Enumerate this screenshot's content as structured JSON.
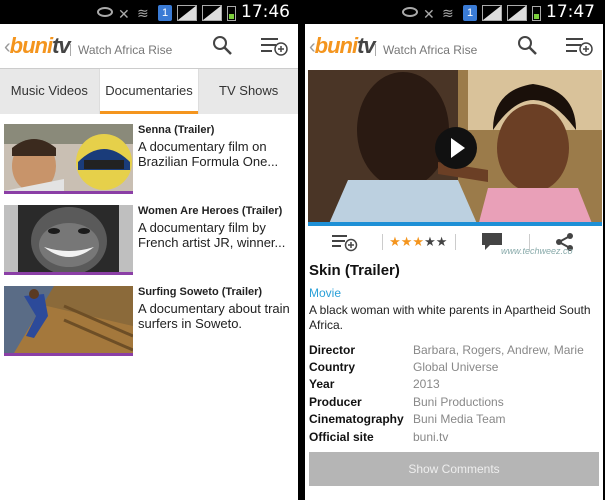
{
  "status": {
    "badge": "1",
    "time_left": "17:46",
    "time_right": "17:47"
  },
  "appbar": {
    "logo_buni": "buni",
    "logo_tv": "tv",
    "tagline": "Watch Africa Rise"
  },
  "tabs": [
    {
      "label": "Music Videos",
      "active": false
    },
    {
      "label": "Documentaries",
      "active": true
    },
    {
      "label": "TV Shows",
      "active": false
    }
  ],
  "list": [
    {
      "title": "Senna (Trailer)",
      "description": "A documentary film on Brazilian Formula One..."
    },
    {
      "title": "Women Are Heroes (Trailer)",
      "description": "A documentary film by French artist JR, winner..."
    },
    {
      "title": "Surfing Soweto (Trailer)",
      "description": "A documentary about train surfers in Soweto."
    }
  ],
  "detail": {
    "rating": 3,
    "rating_max": 5,
    "watermark": "www.techweez.co",
    "title": "Skin (Trailer)",
    "genre": "Movie",
    "description": "A black woman with white parents in Apartheid South Africa.",
    "meta": [
      {
        "key": "Director",
        "value": "Barbara, Rogers, Andrew, Marie"
      },
      {
        "key": "Country",
        "value": "Global Universe"
      },
      {
        "key": "Year",
        "value": "2013"
      },
      {
        "key": "Producer",
        "value": "Buni Productions"
      },
      {
        "key": "Cinematography",
        "value": "Buni Media Team"
      },
      {
        "key": "Official site",
        "value": "buni.tv"
      }
    ],
    "comments_button": "Show Comments"
  },
  "colors": {
    "brand_orange": "#f4951e",
    "accent_blue": "#1e90d6",
    "thumb_underline": "#8b3fa6"
  }
}
